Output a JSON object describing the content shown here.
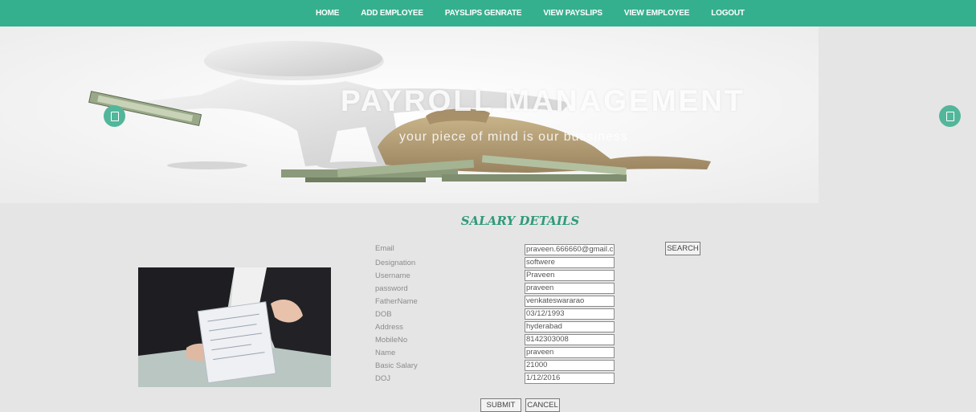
{
  "nav": {
    "items": [
      {
        "label": "HOME"
      },
      {
        "label": "ADD EMPLOYEE"
      },
      {
        "label": "PAYSLIPS GENRATE"
      },
      {
        "label": "VIEW PAYSLIPS"
      },
      {
        "label": "VIEW EMPLOYEE"
      },
      {
        "label": "LOGOUT"
      }
    ]
  },
  "banner": {
    "title": "PAYROLL MANAGEMENT",
    "subtitle": "your piece of mind is our bussiness"
  },
  "form": {
    "title": "SALARY DETAILS",
    "fields": [
      {
        "label": "Email",
        "value": "praveen.666660@gmail.c"
      },
      {
        "label": "Designation",
        "value": "softwere"
      },
      {
        "label": "Username",
        "value": "Praveen"
      },
      {
        "label": "password",
        "value": "praveen"
      },
      {
        "label": "FatherName",
        "value": "venkateswararao"
      },
      {
        "label": "DOB",
        "value": "03/12/1993"
      },
      {
        "label": "Address",
        "value": "hyderabad"
      },
      {
        "label": "MobileNo",
        "value": "8142303008"
      },
      {
        "label": "Name",
        "value": "praveen"
      },
      {
        "label": "Basic Salary",
        "value": "21000"
      },
      {
        "label": "DOJ",
        "value": "1/12/2016"
      }
    ],
    "search_label": "SEARCH",
    "submit_label": "SUBMIT",
    "cancel_label": "CANCEL"
  },
  "colors": {
    "accent": "#35b08f",
    "title": "#2f9a7a",
    "background": "#e5e5e5"
  },
  "icons": {
    "prev": "carousel-prev-icon",
    "next": "carousel-next-icon"
  }
}
